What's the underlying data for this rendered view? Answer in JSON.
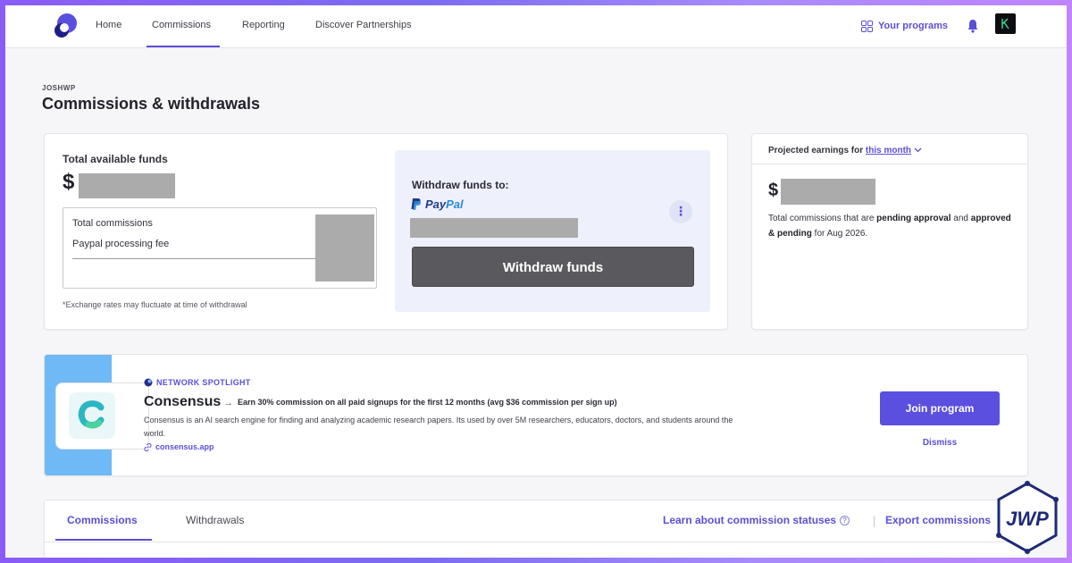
{
  "nav": {
    "home": "Home",
    "commissions": "Commissions",
    "reporting": "Reporting",
    "discover": "Discover Partnerships",
    "your_programs": "Your programs"
  },
  "header": {
    "org": "JOSHWP",
    "title": "Commissions & withdrawals"
  },
  "funds": {
    "label": "Total available funds",
    "currency": "$",
    "total_commissions": "Total commissions",
    "processing_fee": "Paypal processing fee",
    "fine_print": "*Exchange rates may fluctuate at time of withdrawal",
    "withdraw_to": "Withdraw funds to:",
    "paypal_pay": "Pay",
    "paypal_pal": "Pal",
    "withdraw_button": "Withdraw funds"
  },
  "projected": {
    "label_prefix": "Projected earnings for",
    "period": "this month",
    "currency": "$",
    "desc_1": "Total commissions that are ",
    "desc_b1": "pending approval",
    "desc_2": " and ",
    "desc_b2": "approved & pending",
    "desc_3": " for Aug 2026."
  },
  "spotlight": {
    "tag": "NETWORK SPOTLIGHT",
    "name": "Consensus",
    "arrow": "→",
    "offer": "Earn 30% commission on all paid signups for the first 12 months (avg $36 commission per sign up)",
    "description": "Consensus is an AI search engine for finding and analyzing academic research papers. Its used by over 5M researchers, educators, doctors, and students around the world.",
    "link": "consensus.app",
    "join_button": "Join program",
    "dismiss": "Dismiss"
  },
  "tabs": {
    "commissions": "Commissions",
    "withdrawals": "Withdrawals",
    "learn": "Learn about commission statuses",
    "help": "?",
    "export": "Export commissions"
  },
  "colors": {
    "accent": "#5b4fd6",
    "spotlight_stripe": "#6fb9f6",
    "withdraw_button": "#5a5a5e"
  }
}
